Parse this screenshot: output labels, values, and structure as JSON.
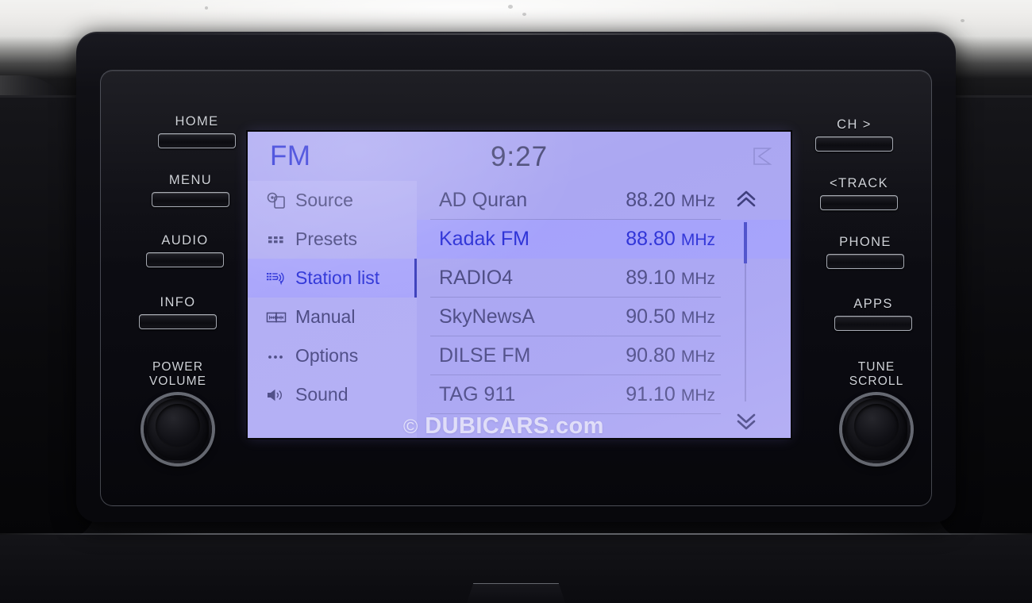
{
  "screen": {
    "mode_label": "FM",
    "clock": "9:27",
    "status_icon": "signal-mute-icon",
    "colors": {
      "screen_background": "#aba7f2",
      "menu_background": "#b3aff4",
      "menu_active_background": "#aaa6fb",
      "row_selected_background": "#a5a2fb",
      "accent_blue": "#2f35d8",
      "text_muted": "#4b4a82"
    },
    "menu": {
      "items": [
        {
          "label": "Source",
          "icon": "source-disc-icon",
          "active": false
        },
        {
          "label": "Presets",
          "icon": "presets-grid-icon",
          "active": false
        },
        {
          "label": "Station list",
          "icon": "station-list-icon",
          "active": true
        },
        {
          "label": "Manual",
          "icon": "manual-tuner-icon",
          "active": false
        },
        {
          "label": "Options",
          "icon": "options-dots-icon",
          "active": false
        },
        {
          "label": "Sound",
          "icon": "speaker-icon",
          "active": false
        }
      ]
    },
    "station_list": {
      "unit": "MHz",
      "stations": [
        {
          "name": "AD Quran",
          "frequency": "88.20",
          "selected": false
        },
        {
          "name": "Kadak FM",
          "frequency": "88.80",
          "selected": true
        },
        {
          "name": "RADIO4",
          "frequency": "89.10",
          "selected": false
        },
        {
          "name": "SkyNewsA",
          "frequency": "90.50",
          "selected": false
        },
        {
          "name": "DILSE FM",
          "frequency": "90.80",
          "selected": false
        },
        {
          "name": "TAG 911",
          "frequency": "91.10",
          "selected": false
        }
      ],
      "scroll": {
        "up_icon": "chevron-double-up-icon",
        "down_icon": "chevron-double-down-icon",
        "thumb_position_percent": 8
      }
    },
    "watermark": {
      "symbol": "©",
      "text": "DUBICARS.com"
    }
  },
  "hardware": {
    "left_buttons": [
      {
        "label": "HOME"
      },
      {
        "label": "MENU"
      },
      {
        "label": "AUDIO"
      },
      {
        "label": "INFO"
      }
    ],
    "right_buttons": [
      {
        "label": "CH  >"
      },
      {
        "label": "<TRACK"
      },
      {
        "label": "PHONE"
      },
      {
        "label": "APPS"
      }
    ],
    "left_knob": {
      "label_line1": "POWER",
      "label_line2": "VOLUME"
    },
    "right_knob": {
      "label_line1": "TUNE",
      "label_line2": "SCROLL"
    }
  }
}
